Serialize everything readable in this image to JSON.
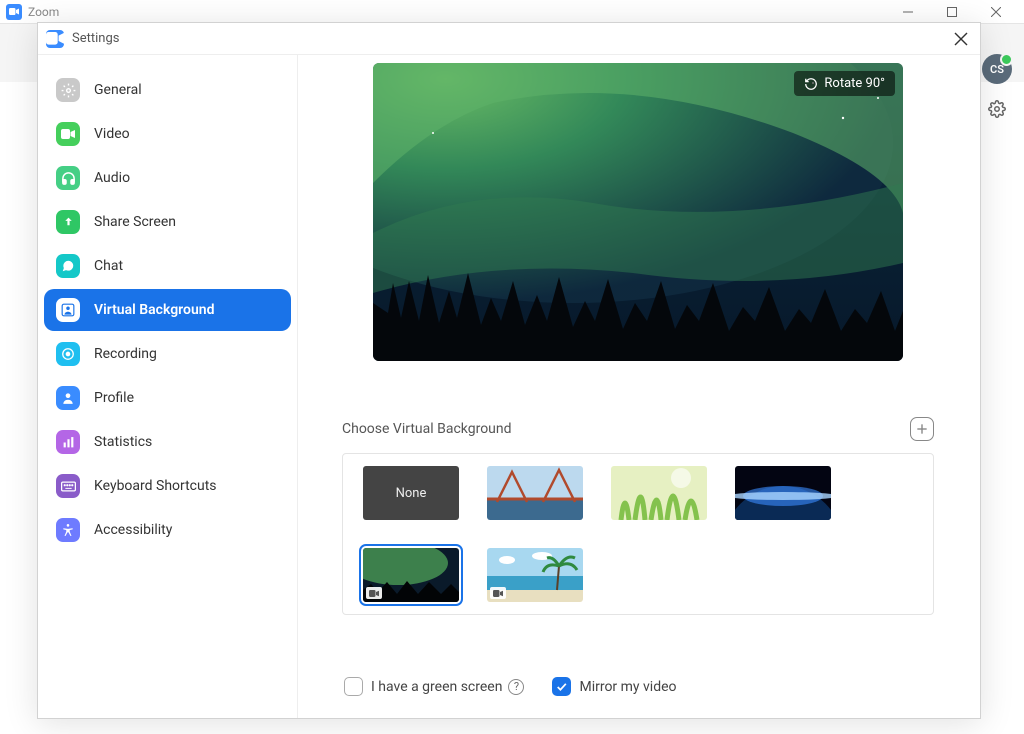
{
  "app": {
    "name": "Zoom"
  },
  "avatar_initials": "CS",
  "settings": {
    "title": "Settings",
    "sidebar": [
      {
        "id": "general",
        "label": "General",
        "color": "#c9c9c9"
      },
      {
        "id": "video",
        "label": "Video",
        "color": "#45cf5c"
      },
      {
        "id": "audio",
        "label": "Audio",
        "color": "#45cf85"
      },
      {
        "id": "share-screen",
        "label": "Share Screen",
        "color": "#2fc765"
      },
      {
        "id": "chat",
        "label": "Chat",
        "color": "#14c8c8"
      },
      {
        "id": "virtual-background",
        "label": "Virtual Background",
        "color": "#1a73e8",
        "active": true
      },
      {
        "id": "recording",
        "label": "Recording",
        "color": "#1fbff0"
      },
      {
        "id": "profile",
        "label": "Profile",
        "color": "#3a8cff"
      },
      {
        "id": "statistics",
        "label": "Statistics",
        "color": "#b466e6"
      },
      {
        "id": "keyboard-shortcuts",
        "label": "Keyboard Shortcuts",
        "color": "#8a5cc9"
      },
      {
        "id": "accessibility",
        "label": "Accessibility",
        "color": "#6e7bff"
      }
    ],
    "rotate_label": "Rotate 90°",
    "choose_label": "Choose Virtual Background",
    "thumbs": {
      "none_label": "None"
    },
    "green_screen_label": "I have a green screen",
    "mirror_label": "Mirror my video"
  }
}
